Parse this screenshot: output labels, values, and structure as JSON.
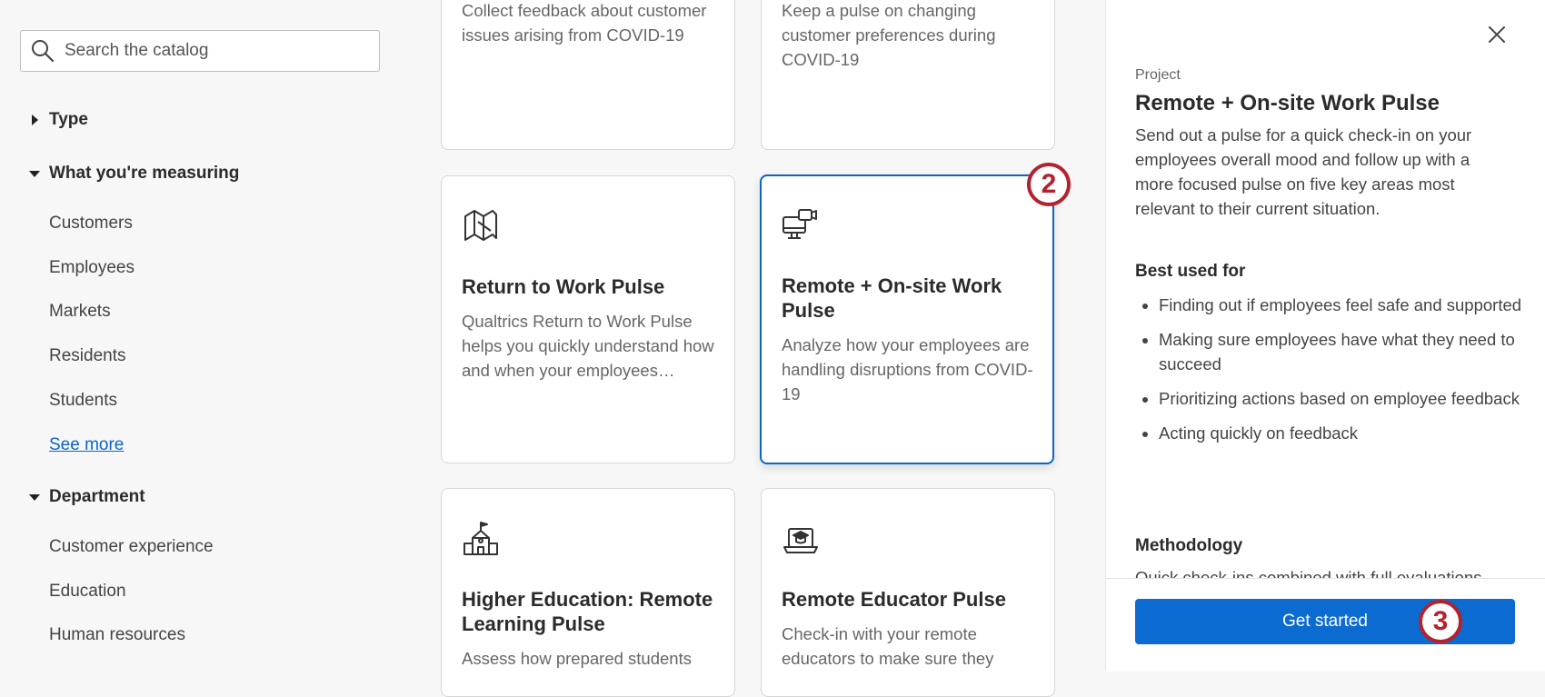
{
  "search": {
    "placeholder": "Search the catalog"
  },
  "filters": {
    "type": {
      "label": "Type",
      "expanded": false
    },
    "measuring": {
      "label": "What you're measuring",
      "expanded": true,
      "options": [
        "Customers",
        "Employees",
        "Markets",
        "Residents",
        "Students"
      ],
      "see_more": "See more"
    },
    "department": {
      "label": "Department",
      "expanded": true,
      "options": [
        "Customer experience",
        "Education",
        "Human resources"
      ]
    }
  },
  "cards": [
    {
      "desc": "Collect feedback about customer issues arising from COVID-19"
    },
    {
      "desc": "Keep a pulse on changing customer preferences during COVID-19"
    },
    {
      "title": "Return to Work Pulse",
      "desc": "Qualtrics Return to Work Pulse helps you quickly understand how and when your employees…",
      "icon": "return-to-work-icon"
    },
    {
      "title": "Remote + On-site Work Pulse",
      "desc": "Analyze how your employees are handling disruptions from COVID-19",
      "icon": "remote-work-icon",
      "selected": true
    },
    {
      "title": "Higher Education: Remote Learning Pulse",
      "desc": "Assess how prepared students",
      "icon": "school-icon"
    },
    {
      "title": "Remote Educator Pulse",
      "desc": "Check-in with your remote educators to make sure they",
      "icon": "laptop-graduation-icon"
    }
  ],
  "panel": {
    "kicker": "Project",
    "title": "Remote + On-site Work Pulse",
    "description": "Send out a pulse for a quick check-in on your employees overall mood and follow up with a more focused pulse on five key areas most relevant to their current situation.",
    "best_used_heading": "Best used for",
    "best_used": [
      "Finding out if employees feel safe and supported",
      "Making sure employees have what they need to succeed",
      "Prioritizing actions based on employee feedback",
      "Acting quickly on feedback"
    ],
    "methodology_heading": "Methodology",
    "methodology_text": "Quick check-ins combined with full evaluations",
    "cta": "Get started"
  },
  "badges": {
    "card": "2",
    "cta": "3"
  },
  "colors": {
    "accent": "#0b6bd1",
    "badge": "#b3232e"
  }
}
